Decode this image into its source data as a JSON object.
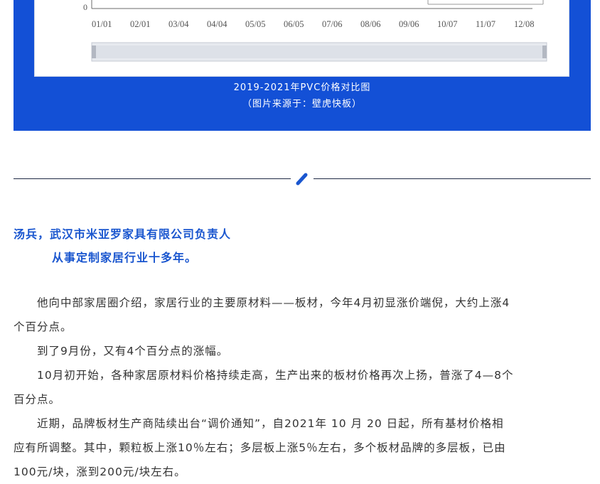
{
  "chart": {
    "y_tick": "0",
    "x_ticks": [
      "01/01",
      "02/01",
      "03/04",
      "04/04",
      "05/05",
      "06/05",
      "07/06",
      "08/06",
      "09/06",
      "10/07",
      "11/07",
      "12/08"
    ]
  },
  "caption": {
    "line1": "2019-2021年PVC价格对比图",
    "line2": "（图片来源于：壁虎快板）"
  },
  "divider": {
    "icon": "pen-icon",
    "color": "#1a56cf"
  },
  "heading": {
    "line1": "汤兵，武汉市米亚罗家具有限公司负责人",
    "line2": "从事定制家居行业十多年。"
  },
  "paragraphs": [
    "他向中部家居圈介绍，家居行业的主要原材料——板材，今年4月初显涨价端倪，大约上涨4",
    "个百分点。",
    "到了9月份，又有4个百分点的涨幅。",
    "10月初开始，各种家居原材料价格持续走高，生产出来的板材价格再次上扬，普涨了4—8个",
    "百分点。",
    "近期，品牌板材生产商陆续出台“调价通知”，自2021年 10 月 20 日起，所有基材价格相",
    "应有所调整。其中，颗粒板上涨10％左右；多层板上涨5％左右，多个板材品牌的多层板，已由",
    "100元/块，涨到200元/块左右。"
  ],
  "colors": {
    "panel": "#1350d6",
    "heading": "#1a56cf",
    "text": "#333333"
  }
}
